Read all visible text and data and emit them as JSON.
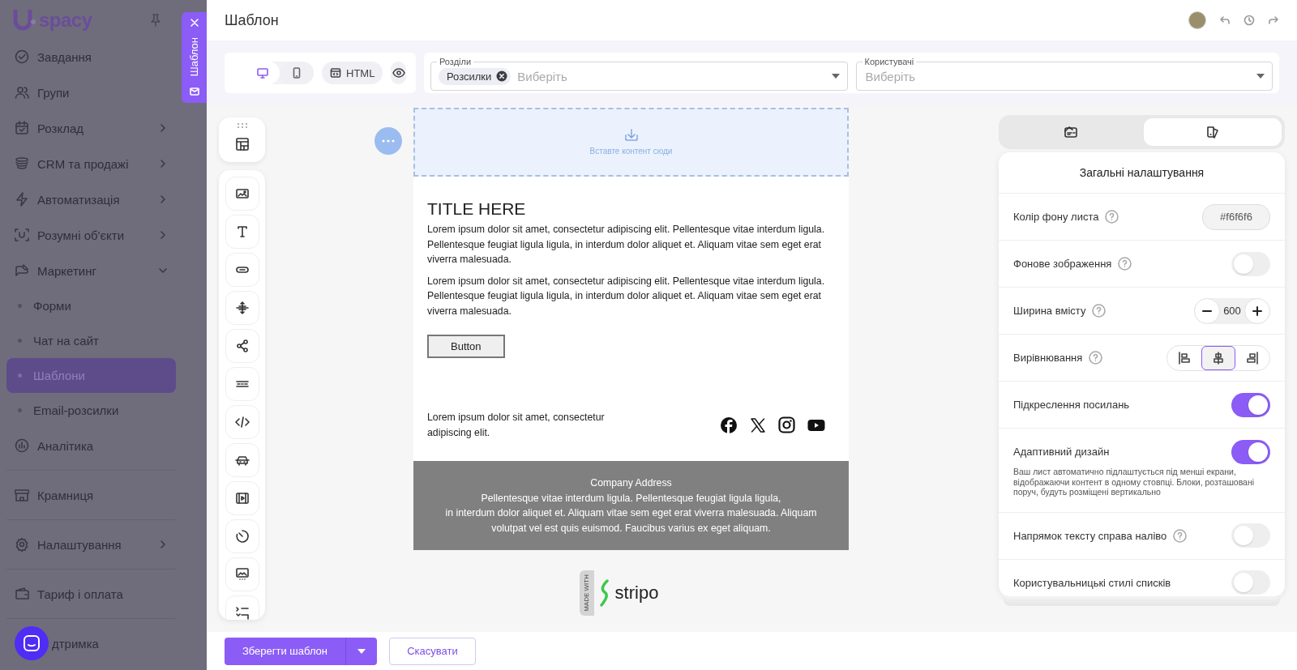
{
  "sidebar": {
    "logo": "spacy",
    "groups": [
      [
        {
          "label": "Завдання",
          "selected": false,
          "has_submenu": false
        },
        {
          "label": "Групи",
          "selected": false,
          "has_submenu": false
        },
        {
          "label": "Розклад",
          "selected": false,
          "has_submenu": true,
          "expanded": false
        },
        {
          "label": "CRM та продажі",
          "selected": false,
          "has_submenu": true,
          "expanded": false
        },
        {
          "label": "Автоматизація",
          "selected": false,
          "has_submenu": true,
          "expanded": false
        },
        {
          "label": "Розумні об'єкти",
          "selected": false,
          "has_submenu": true,
          "expanded": false
        },
        {
          "label": "Маркетинг",
          "selected": false,
          "has_submenu": true,
          "expanded": true,
          "children": [
            {
              "label": "Форми",
              "selected": false
            },
            {
              "label": "Чат на сайт",
              "selected": false
            },
            {
              "label": "Шаблони",
              "selected": true
            },
            {
              "label": "Email-розсилки",
              "selected": false
            }
          ]
        },
        {
          "label": "Аналітика",
          "selected": false,
          "has_submenu": false
        }
      ],
      [
        {
          "label": "Крамниця",
          "selected": false,
          "has_submenu": false
        }
      ],
      [
        {
          "label": "Налаштування",
          "selected": false,
          "has_submenu": true,
          "expanded": false
        }
      ],
      [
        {
          "label": "Тариф і оплата",
          "selected": false,
          "has_submenu": false
        }
      ],
      [
        {
          "label": "дтримка",
          "selected": false,
          "has_submenu": false
        }
      ]
    ]
  },
  "side_tab": {
    "label": "Шаблон"
  },
  "header": {
    "title": "Шаблон"
  },
  "toolbar": {
    "view_modes": [
      {
        "selected": true
      },
      {
        "selected": false
      }
    ],
    "html_button": "HTML",
    "fields": [
      {
        "label": "Розділи",
        "chips": [
          "Розсилки"
        ],
        "placeholder": "Виберіть"
      },
      {
        "label": "Користувачі",
        "placeholder": "Виберіть"
      }
    ]
  },
  "email": {
    "drop_zone": "Вставте контент сюди",
    "title": "TITLE HERE",
    "paragraphs": [
      "Lorem ipsum dolor sit amet, consectetur adipiscing elit. Pellentesque vitae interdum ligula. Pellentesque feugiat ligula ligula, in interdum dolor aliquet et. Aliquam vitae sem eget erat viverra malesuada.",
      "Lorem ipsum dolor sit amet, consectetur adipiscing elit. Pellentesque vitae interdum ligula. Pellentesque feugiat ligula ligula, in interdum dolor aliquet et. Aliquam vitae sem eget erat viverra malesuada."
    ],
    "button": "Button",
    "footer_text": "Lorem ipsum dolor sit amet, consectetur adipiscing elit.",
    "address_title": "Company Address",
    "address_lines": [
      "Pellentesque vitae interdum ligula. Pellentesque feugiat ligula ligula,",
      "in interdum dolor aliquet et. Aliquam vitae sem eget erat viverra malesuada. Aliquam",
      "volutpat vel est quis euismod. Faucibus varius ex eget aliquam."
    ]
  },
  "badge": {
    "made_with": "MADE WITH",
    "brand": "stripo"
  },
  "settings": {
    "tabs": [
      {
        "selected": false
      },
      {
        "selected": true
      }
    ],
    "title": "Загальні налаштування",
    "rows": [
      {
        "kind": "color",
        "label": "Колір фону листа",
        "help": true,
        "value": "#f6f6f6"
      },
      {
        "kind": "toggle",
        "label": "Фонове зображення",
        "help": true,
        "on": false
      },
      {
        "kind": "stepper",
        "label": "Ширина вмісту",
        "help": true,
        "value": "600"
      },
      {
        "kind": "align",
        "label": "Вирівнювання",
        "help": true,
        "options": [
          {
            "selected": false
          },
          {
            "selected": true
          },
          {
            "selected": false
          }
        ]
      },
      {
        "kind": "toggle",
        "label": "Підкреслення посилань",
        "help": false,
        "on": true
      },
      {
        "kind": "toggle",
        "label": "Адаптивний дизайн",
        "help": false,
        "on": true,
        "note": "Ваш лист автоматично підлаштується під менші екрани, відображаючи контент в одному стовпці. Блоки, розташовані поруч, будуть розміщені вертикально"
      },
      {
        "kind": "toggle",
        "label": "Напрямок тексту справа наліво",
        "help": true,
        "on": false
      },
      {
        "kind": "toggle",
        "label": "Користувальницькі стилі списків",
        "help": false,
        "on": false
      }
    ]
  },
  "footer": {
    "save": "Зберегти шаблон",
    "cancel": "Скасувати"
  }
}
